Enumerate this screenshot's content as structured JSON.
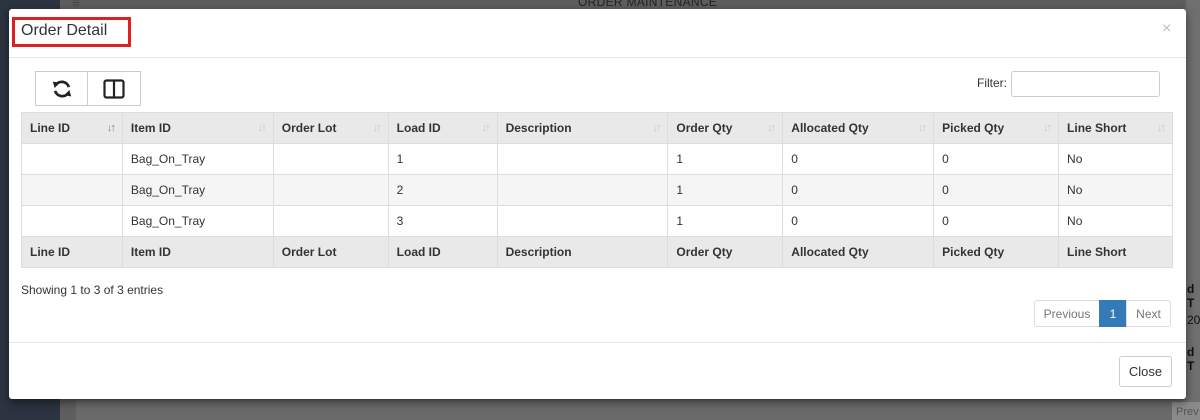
{
  "background": {
    "title": "ORDER MAINTENANCE",
    "hamburger_glyph": "≡",
    "frag1": "d T",
    "frag2": "20",
    "frag3": "d T",
    "prev_frag": "Prev"
  },
  "modal": {
    "title": "Order Detail",
    "close_glyph": "×",
    "toolbar": [
      {
        "name": "refresh-icon"
      },
      {
        "name": "columns-icon"
      }
    ],
    "filter": {
      "label": "Filter:",
      "value": "",
      "placeholder": ""
    },
    "columns": [
      "Line ID",
      "Item ID",
      "Order Lot",
      "Load ID",
      "Description",
      "Order Qty",
      "Allocated Qty",
      "Picked Qty",
      "Line Short"
    ],
    "sorted_column": "Line ID",
    "rows": [
      [
        "",
        "Bag_On_Tray",
        "",
        "1",
        "",
        "1",
        "0",
        "0",
        "No"
      ],
      [
        "",
        "Bag_On_Tray",
        "",
        "2",
        "",
        "1",
        "0",
        "0",
        "No"
      ],
      [
        "",
        "Bag_On_Tray",
        "",
        "3",
        "",
        "1",
        "0",
        "0",
        "No"
      ]
    ],
    "showing": "Showing 1 to 3 of 3 entries",
    "pagination": {
      "previous": "Previous",
      "current": "1",
      "next": "Next"
    },
    "footer": {
      "close_label": "Close"
    }
  },
  "colors": {
    "highlight_box": "#e02020",
    "page_active": "#337ab7"
  }
}
